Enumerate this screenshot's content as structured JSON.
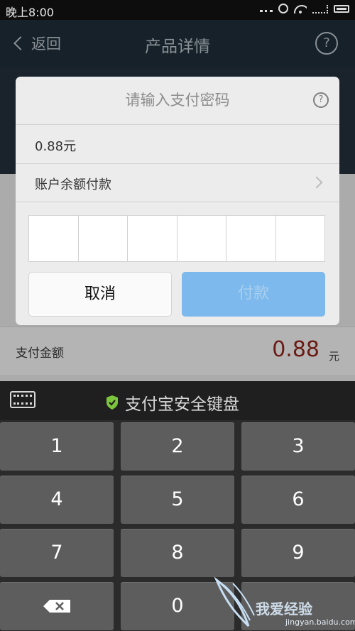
{
  "status_bar": {
    "time": "晚上8:00"
  },
  "header": {
    "back_label": "返回",
    "title": "产品详情"
  },
  "background": {
    "pay_amount_label": "支付金额",
    "pay_amount_value": "0.88",
    "pay_amount_unit": "元"
  },
  "dialog": {
    "title": "请输入支付密码",
    "amount": "0.88元",
    "payment_method": "账户余额付款",
    "password_length": 6,
    "cancel_label": "取消",
    "pay_label": "付款"
  },
  "keyboard": {
    "title": "支付宝安全键盘",
    "keys": [
      "1",
      "2",
      "3",
      "4",
      "5",
      "6",
      "7",
      "8",
      "9",
      "0"
    ]
  },
  "watermark": {
    "text": "我爱经验",
    "sub": "jingyan.baidu.com"
  },
  "colors": {
    "pay_button": "#7db9ec",
    "amount_value": "#6a1b14",
    "keyboard_key": "#5d5d5d"
  }
}
